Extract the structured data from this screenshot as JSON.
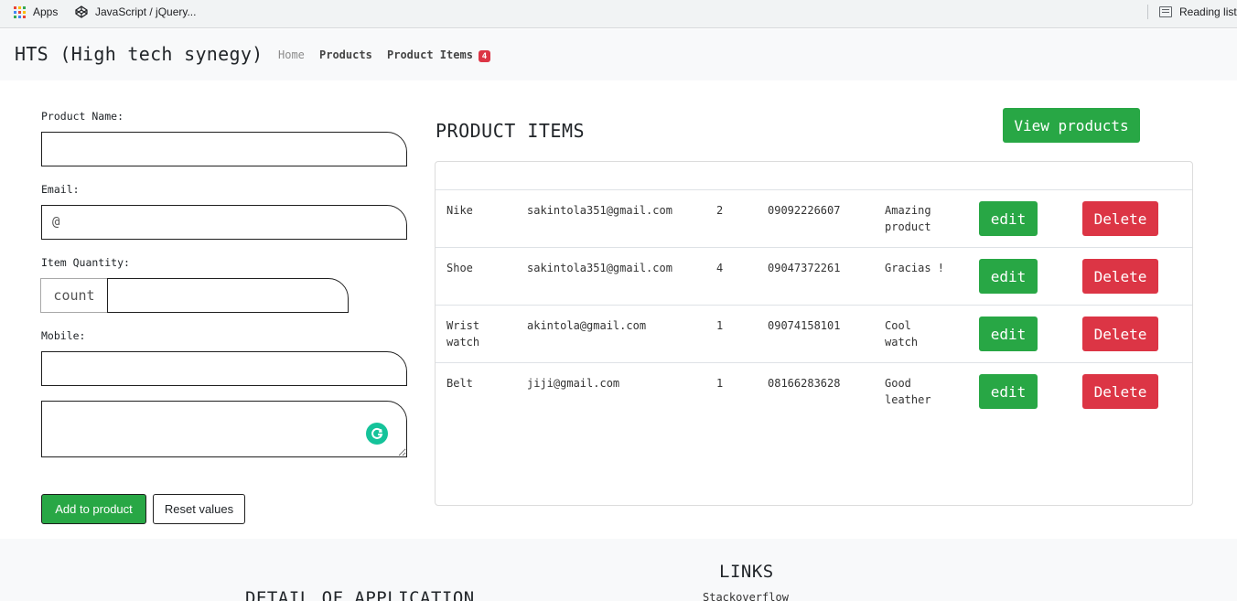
{
  "bookmarks": {
    "apps_label": "Apps",
    "codepen_label": "JavaScript / jQuery...",
    "reading_list_label": "Reading list"
  },
  "navbar": {
    "brand": "HTS (High tech synegy)",
    "home": "Home",
    "products": "Products",
    "product_items": "Product Items",
    "badge_count": "4"
  },
  "form": {
    "product_name_label": "Product Name:",
    "email_label": "Email:",
    "email_placeholder": "@",
    "quantity_label": "Item Quantity:",
    "quantity_addon": "count",
    "mobile_label": "Mobile:",
    "add_button": "Add to product",
    "reset_button": "Reset values"
  },
  "items": {
    "title": "PRODUCT ITEMS",
    "view_button": "View products",
    "edit_label": "edit",
    "delete_label": "Delete",
    "rows": [
      {
        "name": "Nike",
        "email": "sakintola351@gmail.com",
        "quantity": "2",
        "mobile": "09092226607",
        "description": "Amazing product"
      },
      {
        "name": "Shoe",
        "email": "sakintola351@gmail.com",
        "quantity": "4",
        "mobile": "09047372261",
        "description": "Gracias !"
      },
      {
        "name": "Wrist watch",
        "email": "akintola@gmail.com",
        "quantity": "1",
        "mobile": "09074158101",
        "description": "Cool watch"
      },
      {
        "name": "Belt",
        "email": "jiji@gmail.com",
        "quantity": "1",
        "mobile": "08166283628",
        "description": "Good leather"
      }
    ]
  },
  "footer": {
    "detail_title": "DETAIL OF APPLICATION",
    "links_title": "LINKS",
    "stackoverflow": "Stackoverflow"
  },
  "colors": {
    "primary_green": "#28a745",
    "danger_red": "#dc3545",
    "grammarly_green": "#15c39a"
  }
}
